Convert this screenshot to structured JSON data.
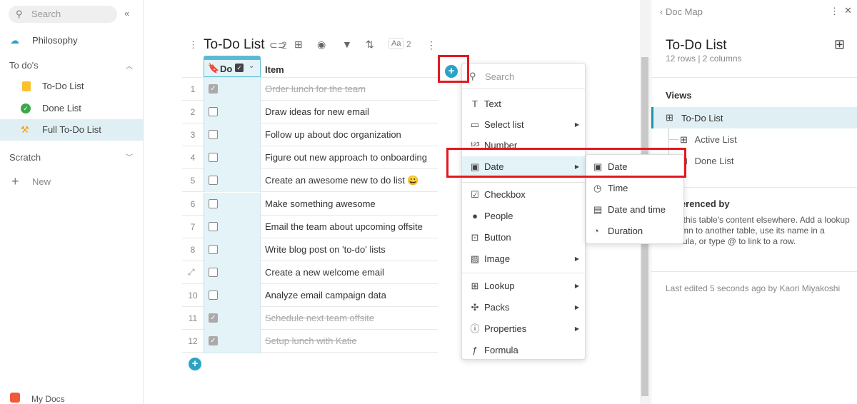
{
  "sidebar": {
    "search_placeholder": "Search",
    "collapse_icon": "«",
    "items": [
      {
        "label": "Philosophy"
      }
    ],
    "sections": [
      {
        "label": "To do's",
        "items": [
          {
            "label": "To-Do List"
          },
          {
            "label": "Done List"
          },
          {
            "label": "Full To-Do List",
            "selected": true
          }
        ]
      },
      {
        "label": "Scratch"
      }
    ],
    "new_label": "New",
    "footer_label": "My Docs"
  },
  "table": {
    "title": "To-Do List",
    "link_count": "2",
    "font_count": "2",
    "font_label": "Aa",
    "col_do": "Do",
    "col_item": "Item",
    "rows": [
      {
        "n": "1",
        "done": true,
        "item": "Order lunch for the team"
      },
      {
        "n": "2",
        "done": false,
        "item": "Draw ideas for new email"
      },
      {
        "n": "3",
        "done": false,
        "item": "Follow up about doc organization"
      },
      {
        "n": "4",
        "done": false,
        "item": "Figure out new approach to onboarding"
      },
      {
        "n": "5",
        "done": false,
        "item": "Create an awesome new to do list 😀"
      },
      {
        "n": "6",
        "done": false,
        "item": "Make something awesome"
      },
      {
        "n": "7",
        "done": false,
        "item": "Email the team about upcoming offsite"
      },
      {
        "n": "8",
        "done": false,
        "item": "Write blog post on 'to-do' lists"
      },
      {
        "n": "",
        "done": false,
        "item": "Create a new welcome email"
      },
      {
        "n": "10",
        "done": false,
        "item": "Analyze email campaign data"
      },
      {
        "n": "11",
        "done": true,
        "item": "Schedule next team offsite"
      },
      {
        "n": "12",
        "done": true,
        "item": "Setup lunch with Katie"
      }
    ]
  },
  "column_menu": {
    "search_placeholder": "Search",
    "items": [
      "Text",
      "Select list",
      "Number",
      "Date",
      "Checkbox",
      "People",
      "Button",
      "Image",
      "Lookup",
      "Packs",
      "Properties",
      "Formula"
    ],
    "submenu": [
      "Date",
      "Time",
      "Date and time",
      "Duration"
    ]
  },
  "right_panel": {
    "back_label": "Doc Map",
    "title": "To-Do List",
    "subtitle": "12 rows | 2 columns",
    "views_label": "Views",
    "views": [
      "To-Do List",
      "Active List",
      "Done List"
    ],
    "referenced_label": "Referenced by",
    "referenced_text": "Use this table's content elsewhere. Add a lookup column to another table, use its name in a formula, or type @ to link to a row.",
    "last_edited": "Last edited 5 seconds ago by Kaori Miyakoshi"
  },
  "colors": {
    "accent": "#2ba3c4",
    "highlight": "#e3f3f7",
    "annotation": "#e3191f"
  }
}
